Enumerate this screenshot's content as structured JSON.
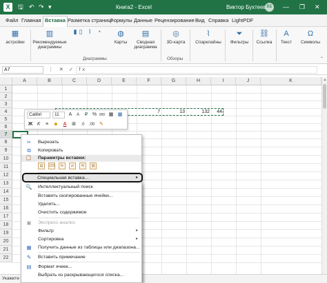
{
  "titlebar": {
    "doc_title": "Книга2 - Excel",
    "user_name": "Виктор Бухтеев",
    "avatar_initials": "ВБ",
    "minimize": "—",
    "restore": "❐",
    "close": "✕"
  },
  "ribbon_tabs": [
    "Файл",
    "Главная",
    "Вставка",
    "Разметка страниц",
    "Формулы",
    "Данные",
    "Рецензирование",
    "Вид",
    "Справка",
    "LightPDF"
  ],
  "active_tab": "Вставка",
  "ribbon": {
    "tables": "астройки",
    "rec_charts": "Рекомендуемые диаграммы",
    "maps": "Карты",
    "pivot_chart": "Сводная диаграмма",
    "map3d": "3D-карта",
    "sparklines": "Спарклайны",
    "filters": "Фильтры",
    "link": "Ссылка",
    "text": "Текст",
    "symbols": "Символы",
    "group_charts": "Диаграммы",
    "group_tours": "Обзоры"
  },
  "formula_bar": {
    "name_box": "A7",
    "icons": "⋮ ✕ ✓ fx"
  },
  "grid": {
    "columns": [
      "A",
      "B",
      "C",
      "D",
      "E",
      "F",
      "G",
      "H",
      "I",
      "J",
      "K"
    ],
    "rows": [
      "1",
      "2",
      "3",
      "4",
      "5",
      "6",
      "7",
      "8",
      "9",
      "10",
      "11",
      "12",
      "13",
      "14",
      "15",
      "16",
      "17",
      "18",
      "19",
      "20",
      "21",
      "22"
    ],
    "row4_values": [
      "7",
      "13",
      "132",
      "44"
    ]
  },
  "mini_toolbar": {
    "font": "Calibri",
    "size": "11"
  },
  "context_menu": {
    "cut": "Вырезать",
    "copy": "Копировать",
    "paste_options": "Параметры вставки:",
    "paste_special": "Специальная вставка...",
    "smart_lookup": "Интеллектуальный поиск",
    "insert_copied": "Вставить скопированные ячейки...",
    "delete": "Удалить...",
    "clear": "Очистить содержимое",
    "quick_analysis": "Экспресс-анализ",
    "filter": "Фильтр",
    "sort": "Сортировка",
    "get_data": "Получить данные из таблицы или диапазона...",
    "insert_note": "Вставить примечание",
    "format_cells": "Формат ячеек...",
    "pick_list": "Выбрать из раскрывающегося списка..."
  },
  "statusbar": {
    "text": "Укажите яче"
  }
}
